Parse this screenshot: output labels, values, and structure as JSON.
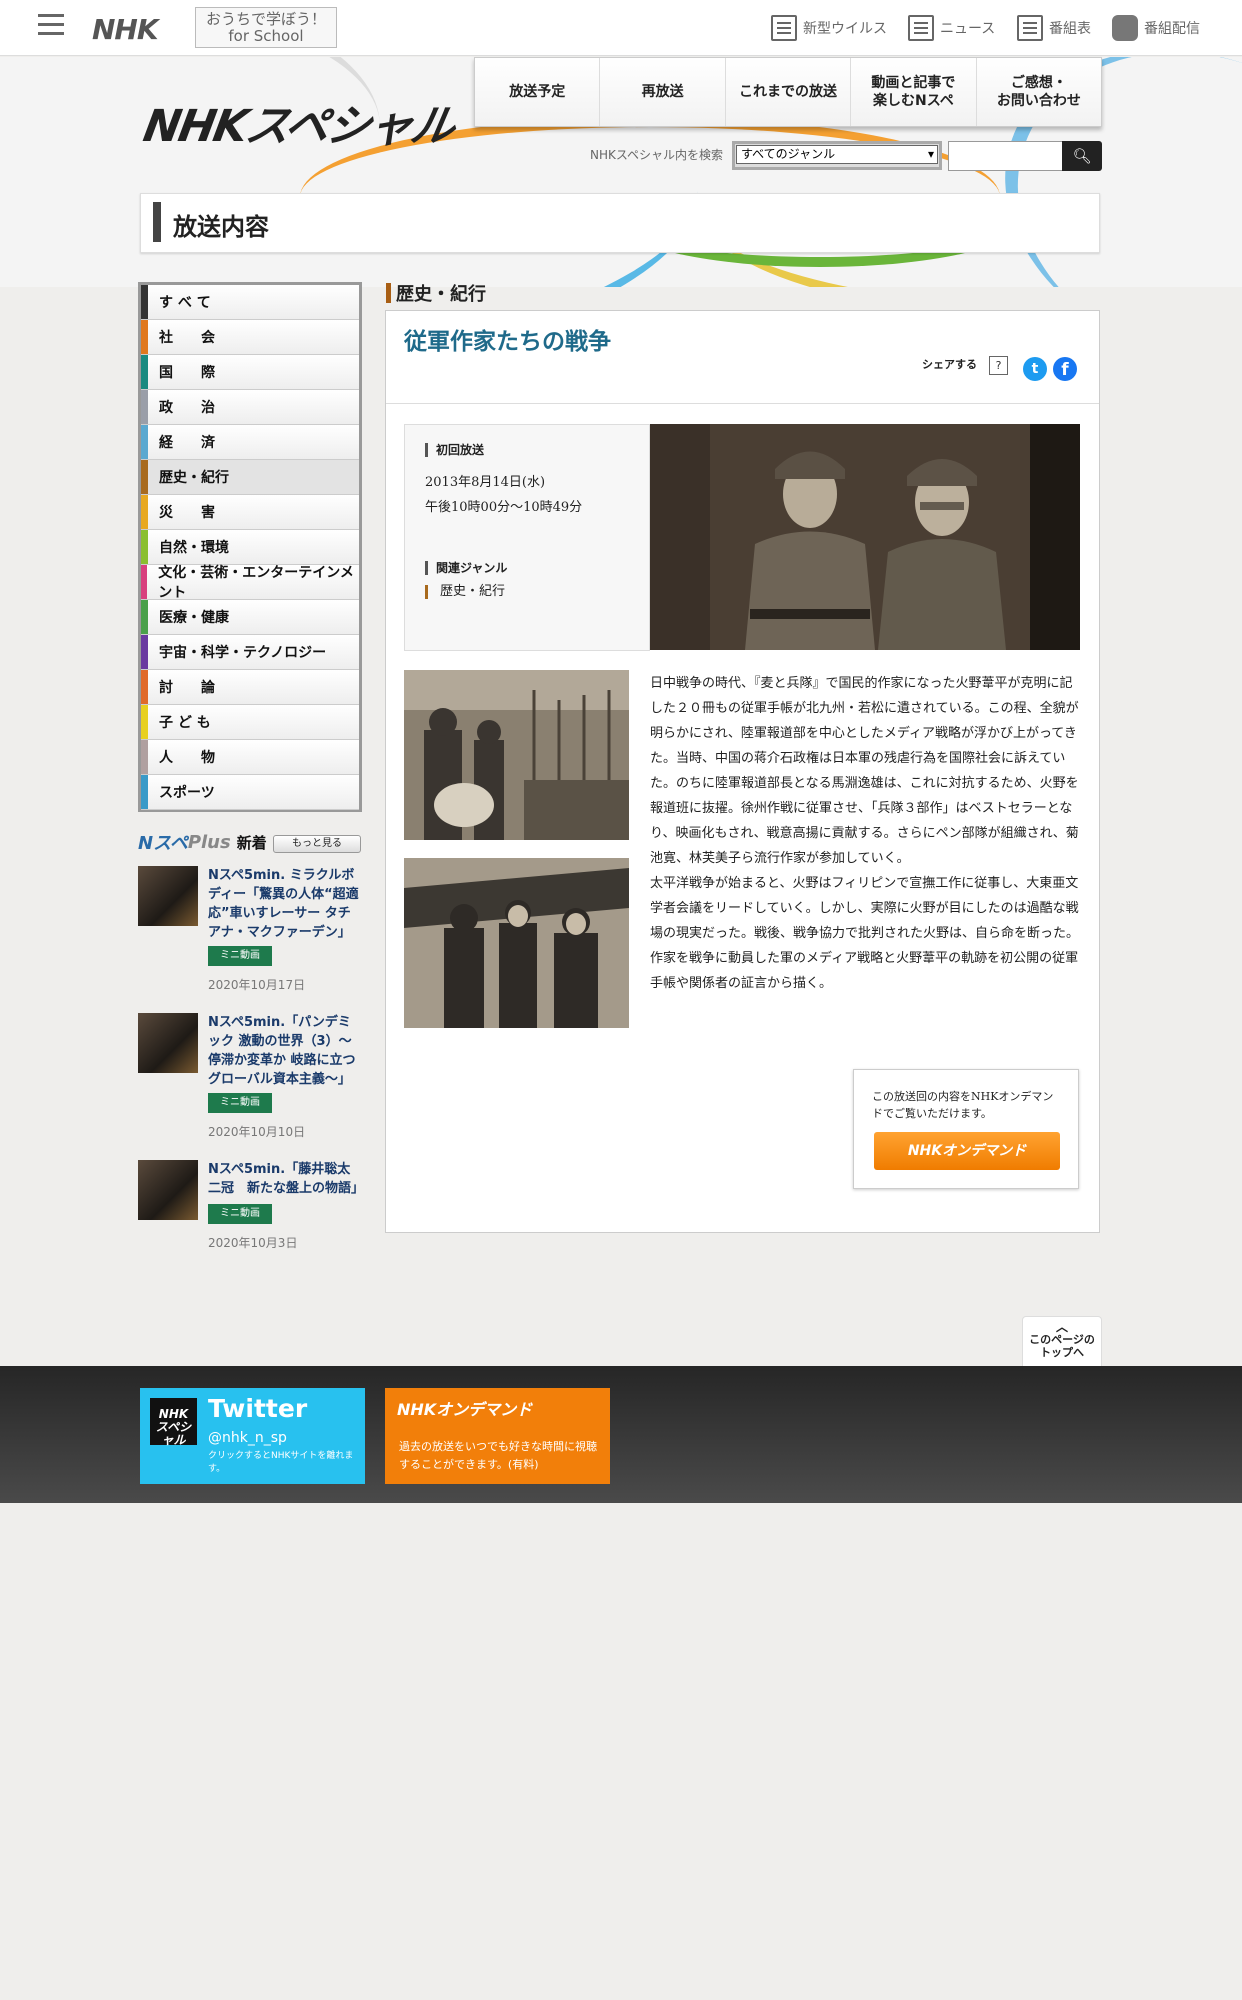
{
  "global_header": {
    "logo": "NHK",
    "school_line1": "おうちで学ぼう！",
    "school_line2": "for School",
    "links": [
      {
        "label": "新型ウイルス",
        "icon": "virus-news-icon"
      },
      {
        "label": "ニュース",
        "icon": "news-icon"
      },
      {
        "label": "番組表",
        "icon": "program-guide-icon"
      },
      {
        "label": "番組配信",
        "icon": "streaming-icon"
      }
    ]
  },
  "program_header": {
    "logo": "NHKスペシャル",
    "nav": [
      "放送予定",
      "再放送",
      "これまでの放送",
      "動画と記事で\n楽しむNスペ",
      "ご感想・\nお問い合わせ"
    ],
    "search_label": "NHKスペシャル内を検索",
    "search_select": "すべてのジャンル",
    "search_placeholder": "",
    "page_title": "放送内容"
  },
  "genre_menu": [
    {
      "label": "す べ て",
      "color": "#333333"
    },
    {
      "label": "社　　会",
      "color": "#e0781e"
    },
    {
      "label": "国　　際",
      "color": "#1a8a80"
    },
    {
      "label": "政　　治",
      "color": "#9a9ea8"
    },
    {
      "label": "経　　済",
      "color": "#5aa8d0"
    },
    {
      "label": "歴史・紀行",
      "color": "#a86a1e",
      "active": true
    },
    {
      "label": "災　　害",
      "color": "#e8a820"
    },
    {
      "label": "自然・環境",
      "color": "#8abf30"
    },
    {
      "label": "文化・芸術・エンターテインメント",
      "color": "#d8407e"
    },
    {
      "label": "医療・健康",
      "color": "#4aa04a"
    },
    {
      "label": "宇宙・科学・テクノロジー",
      "color": "#6a3aa0"
    },
    {
      "label": "討　　論",
      "color": "#e06a2a"
    },
    {
      "label": "子 ど も",
      "color": "#e8d020"
    },
    {
      "label": "人　　物",
      "color": "#b0a0a0"
    },
    {
      "label": "スポーツ",
      "color": "#3a9ac8"
    }
  ],
  "nplus": {
    "logo_a": "Nスペ",
    "logo_b": "Plus",
    "heading": "新着",
    "more": "もっと見る",
    "items": [
      {
        "title": "Nスペ5min. ミラクルボディー「驚異の人体“超適応”車いすレーサー タチアナ・マクファーデン」",
        "badge": "ミニ動画",
        "date": "2020年10月17日"
      },
      {
        "title": "Nスペ5min.「パンデミック 激動の世界（3）～停滞か変革か 岐路に立つグローバル資本主義～」",
        "badge": "ミニ動画",
        "date": "2020年10月10日"
      },
      {
        "title": "Nスペ5min.「藤井聡太二冠　新たな盤上の物語」",
        "badge": "ミニ動画",
        "date": "2020年10月3日"
      }
    ]
  },
  "main": {
    "genre": "歴史・紀行",
    "title": "従軍作家たちの戦争",
    "share_label": "シェアする",
    "share_help": "?",
    "twitter_icon_glyph": "t",
    "facebook_icon_glyph": "f",
    "first_broadcast_label": "初回放送",
    "date": "2013年8月14日(水)",
    "time": "午後10時00分～10時49分",
    "related_genre_label": "関連ジャンル",
    "related_genre": "歴史・紀行",
    "description_p1": "日中戦争の時代、『麦と兵隊』で国民的作家になった火野葦平が克明に記した２０冊もの従軍手帳が北九州・若松に遺されている。この程、全貌が明らかにされ、陸軍報道部を中心としたメディア戦略が浮かび上がってきた。当時、中国の蒋介石政権は日本軍の残虐行為を国際社会に訴えていた。のちに陸軍報道部長となる馬淵逸雄は、これに対抗するため、火野を報道班に抜擢。徐州作戦に従軍させ、「兵隊３部作」はベストセラーとなり、映画化もされ、戦意高揚に貢献する。さらにペン部隊が組織され、菊池寛、林芙美子ら流行作家が参加していく。",
    "description_p2": "太平洋戦争が始まると、火野はフィリピンで宣撫工作に従事し、大東亜文学者会議をリードしていく。しかし、実際に火野が目にしたのは過酷な戦場の現実だった。戦後、戦争協力で批判された火野は、自ら命を断った。作家を戦争に動員した軍のメディア戦略と火野葦平の軌跡を初公開の従軍手帳や関係者の証言から描く。",
    "ondemand_text": "この放送回の内容をNHKオンデマンドでご覧いただけます。",
    "ondemand_button": "NHKオンデマンド"
  },
  "to_top": "このページの\nトップへ",
  "footer": {
    "twitter_avatar": "NHK\nスペシャル",
    "twitter_title": "Twitter",
    "twitter_handle": "@nhk_n_sp",
    "twitter_note": "クリックするとNHKサイトを離れます。",
    "ondemand_logo": "NHKオンデマンド",
    "ondemand_desc": "過去の放送をいつでも好きな時間に視聴することができます。(有料)"
  }
}
